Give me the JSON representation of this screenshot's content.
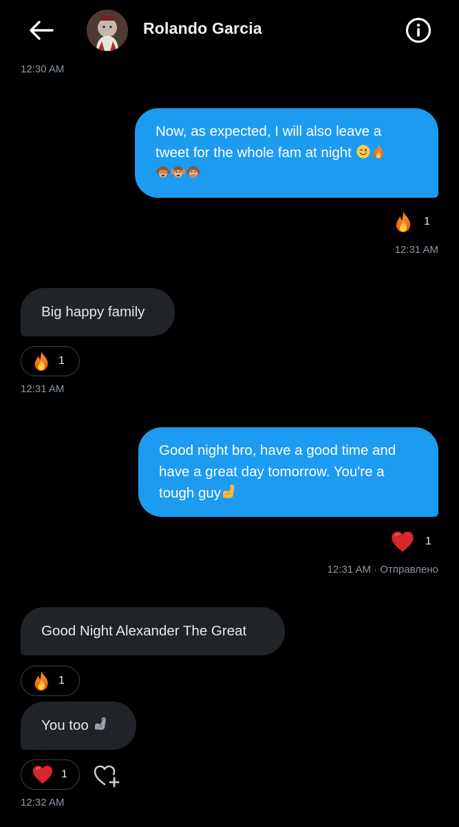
{
  "header": {
    "title": "Rolando Garcia",
    "back_icon": "arrow-left-icon",
    "info_icon": "info-icon"
  },
  "colors": {
    "outgoing_bubble": "#1d9bf0",
    "incoming_bubble": "#202327",
    "timestamp": "#8b98a5",
    "background": "#000000"
  },
  "messages": [
    {
      "timestamp_above": "12:30 AM"
    },
    {
      "direction": "outgoing",
      "line1": "Now, as expected, I will also leave a",
      "line2": "tweet for the whole fam at night",
      "line2_emojis": [
        "winking-face-icon",
        "fire-icon"
      ],
      "line3_emojis": [
        "see-no-evil-monkey-icon",
        "hear-no-evil-monkey-icon",
        "speak-no-evil-monkey-icon"
      ],
      "reaction": {
        "emoji": "fire-icon",
        "count": "1"
      },
      "timestamp": "12:31 AM"
    },
    {
      "direction": "incoming",
      "text": "Big happy family",
      "reaction": {
        "emoji": "fire-icon",
        "count": "1"
      },
      "timestamp": "12:31 AM"
    },
    {
      "direction": "outgoing",
      "line1": "Good night bro, have a good time and",
      "line2": "have a great day tomorrow. You're a",
      "line3": "tough guy",
      "line3_emoji": "flexed-biceps-icon",
      "reaction": {
        "emoji": "red-heart-icon",
        "count": "1"
      },
      "timestamp": "12:31 AM · Отправлено"
    },
    {
      "direction": "incoming",
      "text": "Good Night Alexander The Great",
      "reaction": {
        "emoji": "fire-icon",
        "count": "1"
      }
    },
    {
      "direction": "incoming",
      "text": "You too",
      "text_emoji": "mechanical-arm-icon",
      "reaction": {
        "emoji": "red-heart-icon",
        "count": "1"
      },
      "add_reaction_icon": "heart-plus-icon",
      "timestamp": "12:32 AM"
    }
  ]
}
